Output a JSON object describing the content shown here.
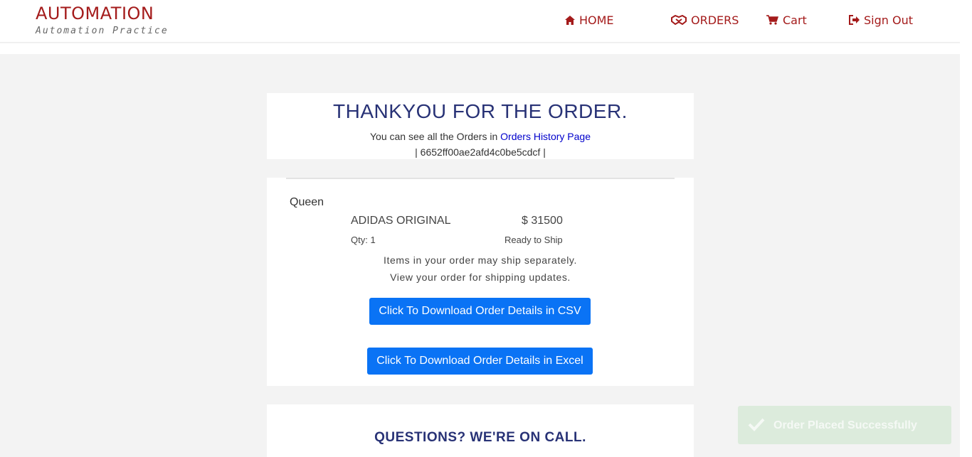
{
  "header": {
    "brand_title": "AUTOMATION",
    "brand_subtitle": "Automation Practice",
    "nav": {
      "home": "HOME",
      "orders": "ORDERS",
      "cart": "Cart",
      "sign_out": "Sign Out"
    },
    "icons": [
      "home-icon",
      "handshake-icon",
      "cart-icon",
      "sign-out-icon"
    ],
    "accent_color": "#a41b1b"
  },
  "thanks": {
    "title": "THANKYOU FOR THE ORDER.",
    "line_prefix": "You can see all the Orders in ",
    "history_link": "Orders History Page",
    "order_id_line": "| 6652ff00ae2afd4c0be5cdcf |"
  },
  "order": {
    "customer": "Queen",
    "product_name": "ADIDAS ORIGINAL",
    "price": "$ 31500",
    "qty": "Qty: 1",
    "status": "Ready to Ship",
    "ship_note_1": "Items in your order may ship separately.",
    "ship_note_2": "View your order for shipping updates.",
    "csv_button": "Click To Download Order Details in CSV",
    "excel_button": "Click To Download Order Details in Excel",
    "button_color": "#0a73f5"
  },
  "questions": {
    "title": "QUESTIONS? WE'RE ON CALL."
  },
  "toast": {
    "message": "Order Placed Successfully",
    "icon": "check-icon",
    "background": "#dcebdc"
  }
}
